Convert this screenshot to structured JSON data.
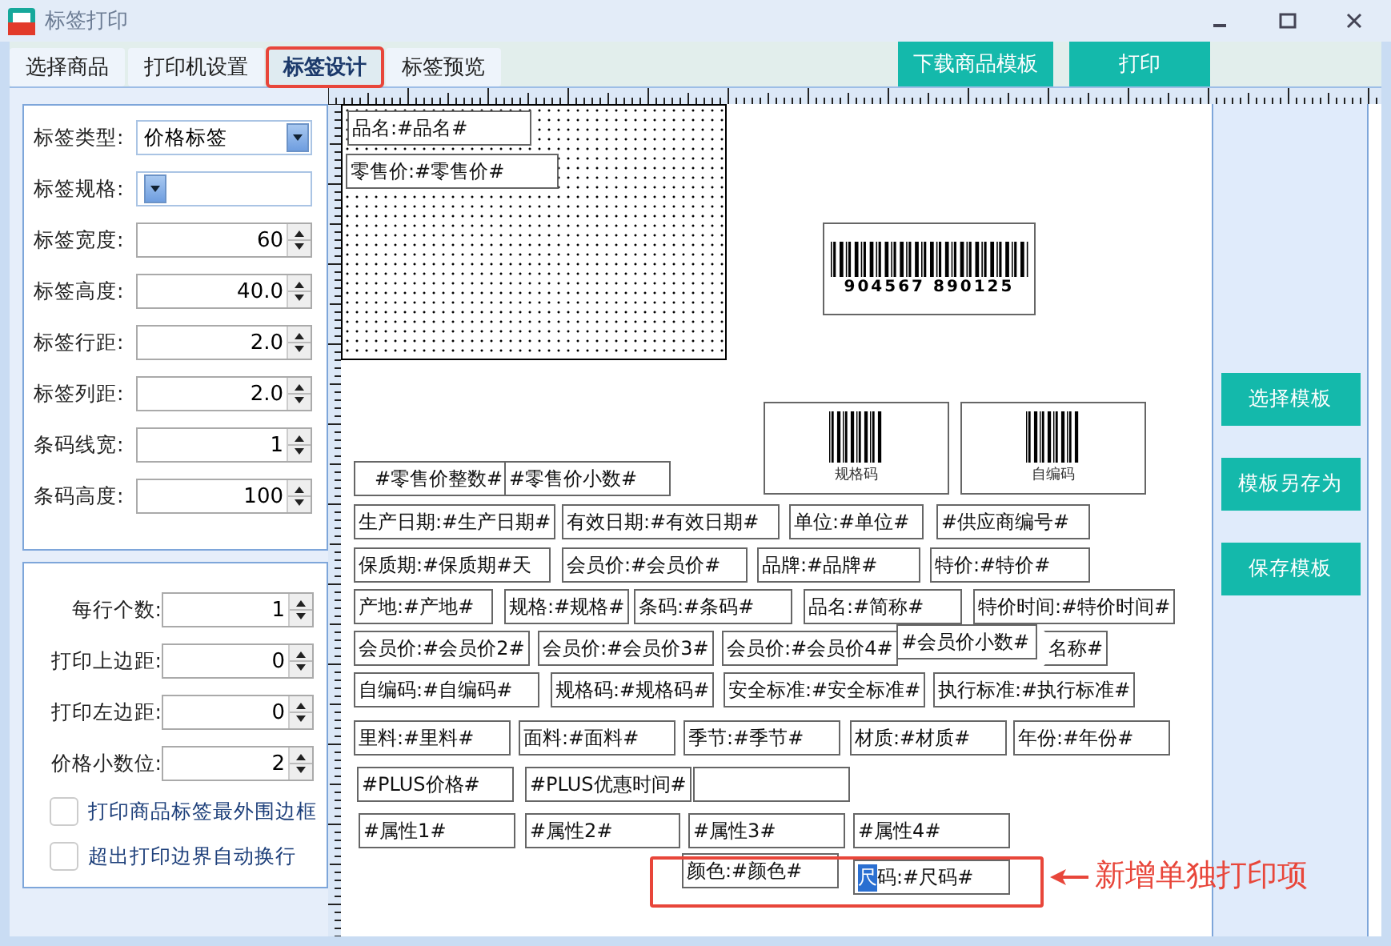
{
  "window": {
    "title": "标签打印"
  },
  "tabs": [
    {
      "label": "选择商品",
      "selected": false,
      "highlighted": false
    },
    {
      "label": "打印机设置",
      "selected": false,
      "highlighted": false
    },
    {
      "label": "标签设计",
      "selected": true,
      "highlighted": true
    },
    {
      "label": "标签预览",
      "selected": false,
      "highlighted": false
    }
  ],
  "toolbar_buttons": [
    "下载商品模板",
    "打印"
  ],
  "label_settings": [
    {
      "kind": "select",
      "label": "标签类型:",
      "value": "价格标签"
    },
    {
      "kind": "select",
      "label": "标签规格:"
    },
    {
      "kind": "spinner",
      "label": "标签宽度:",
      "value": "60"
    },
    {
      "kind": "spinner",
      "label": "标签高度:",
      "value": "40.0"
    },
    {
      "kind": "spinner",
      "label": "标签行距:",
      "value": "2.0"
    },
    {
      "kind": "spinner",
      "label": "标签列距:",
      "value": "2.0"
    },
    {
      "kind": "spinner",
      "label": "条码线宽:",
      "value": "1"
    },
    {
      "kind": "spinner",
      "label": "条码高度:",
      "value": "100"
    }
  ],
  "print_settings": [
    {
      "kind": "spinner",
      "label": "每行个数:",
      "value": "1"
    },
    {
      "kind": "spinner",
      "label": "打印上边距:",
      "value": "0"
    },
    {
      "kind": "spinner",
      "label": "打印左边距:",
      "value": "0"
    },
    {
      "kind": "spinner",
      "label": "价格小数位:",
      "value": "2"
    },
    {
      "kind": "checkbox",
      "label": "打印商品标签最外围边框",
      "checked": false
    },
    {
      "kind": "checkbox",
      "label": "超出打印边界自动换行",
      "checked": false
    }
  ],
  "canvas": {
    "barcodes": [
      {
        "kind": "digits",
        "text": "904567 890125"
      },
      {
        "kind": "caption",
        "text": "规格码"
      },
      {
        "kind": "caption",
        "text": "自编码"
      }
    ],
    "fields": [
      {
        "kind": "text",
        "text": "品名:#品名#"
      },
      {
        "kind": "text",
        "text": "零售价:#零售价#"
      },
      {
        "kind": "text",
        "text": "#零售价整数#"
      },
      {
        "kind": "text",
        "text": "#零售价小数#"
      },
      {
        "kind": "text",
        "text": "生产日期:#生产日期#"
      },
      {
        "kind": "text",
        "text": "有效日期:#有效日期#"
      },
      {
        "kind": "text",
        "text": "单位:#单位#"
      },
      {
        "kind": "text",
        "text": "#供应商编号#"
      },
      {
        "kind": "text",
        "text": "保质期:#保质期#天"
      },
      {
        "kind": "text",
        "text": "会员价:#会员价#"
      },
      {
        "kind": "text",
        "text": "品牌:#品牌#"
      },
      {
        "kind": "text",
        "text": "特价:#特价#"
      },
      {
        "kind": "text",
        "text": "产地:#产地#"
      },
      {
        "kind": "text",
        "text": "规格:#规格#"
      },
      {
        "kind": "text",
        "text": "条码:#条码#"
      },
      {
        "kind": "text",
        "text": "品名:#简称#"
      },
      {
        "kind": "text",
        "text": "特价时间:#特价时间#"
      },
      {
        "kind": "text",
        "text": "会员价:#会员价2#"
      },
      {
        "kind": "text",
        "text": "会员价:#会员价3#"
      },
      {
        "kind": "text",
        "text": "会员价:#会员价4#"
      },
      {
        "kind": "text",
        "text": "#会员价小数#"
      },
      {
        "kind": "text",
        "text": "名称#"
      },
      {
        "kind": "text",
        "text": "自编码:#自编码#"
      },
      {
        "kind": "text",
        "text": "规格码:#规格码#"
      },
      {
        "kind": "text",
        "text": "安全标准:#安全标准#"
      },
      {
        "kind": "text",
        "text": "执行标准:#执行标准#"
      },
      {
        "kind": "text",
        "text": "里料:#里料#"
      },
      {
        "kind": "text",
        "text": "面料:#面料#"
      },
      {
        "kind": "text",
        "text": "季节:#季节#"
      },
      {
        "kind": "text",
        "text": "材质:#材质#"
      },
      {
        "kind": "text",
        "text": "年份:#年份#"
      },
      {
        "kind": "text",
        "text": "#PLUS价格#"
      },
      {
        "kind": "text",
        "text": "#PLUS优惠时间#"
      },
      {
        "kind": "blank"
      },
      {
        "kind": "text",
        "text": "#属性1#"
      },
      {
        "kind": "text",
        "text": "#属性2#"
      },
      {
        "kind": "text",
        "text": "#属性3#"
      },
      {
        "kind": "text",
        "text": "#属性4#"
      },
      {
        "kind": "text",
        "text": "颜色:#颜色#"
      },
      {
        "kind": "text",
        "text": "尺码:#尺码#",
        "editing": true
      }
    ]
  },
  "annotation": {
    "text": "新增单独打印项"
  },
  "side_buttons": [
    "选择模板",
    "模板另存为",
    "保存模板"
  ]
}
